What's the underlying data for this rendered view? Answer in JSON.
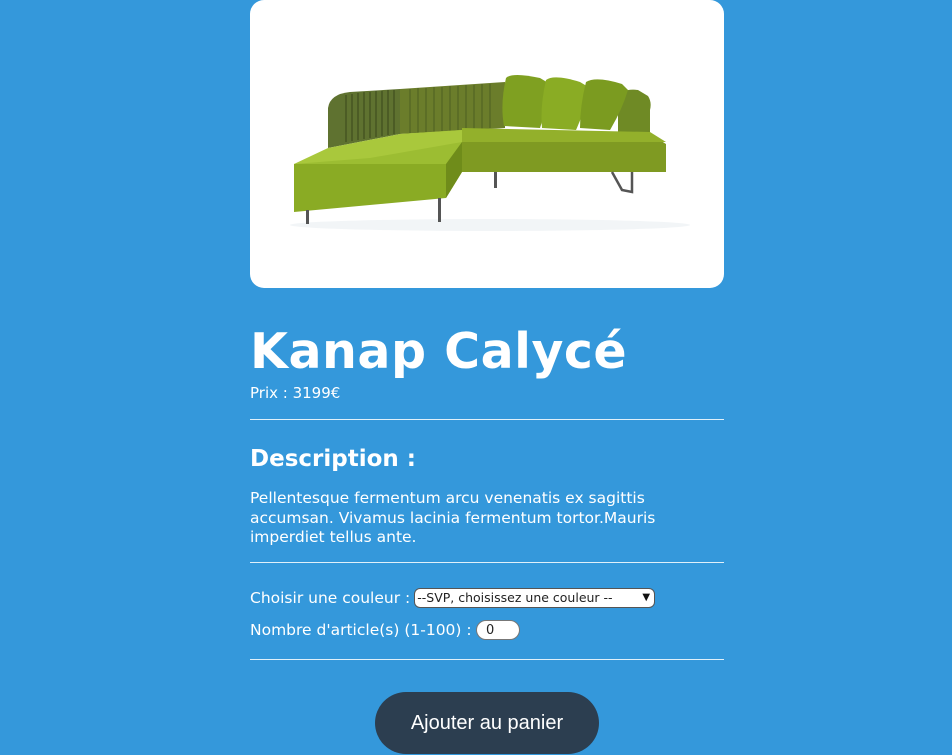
{
  "product": {
    "image_alt": "Photographie d'un canapé vert d'angle",
    "name": "Kanap Calycé",
    "price_label": "Prix : ",
    "price_value": "3199",
    "currency": "€",
    "description_title": "Description :",
    "description_text": "Pellentesque fermentum arcu venenatis ex sagittis accumsan. Vivamus lacinia fermentum tortor.Mauris imperdiet tellus ante."
  },
  "options": {
    "color_label": "Choisir une couleur :",
    "color_selected": "--SVP, choisissez une couleur --",
    "quantity_label": "Nombre d'article(s) (1-100) :",
    "quantity_value": "0"
  },
  "actions": {
    "add_to_cart_label": "Ajouter au panier"
  },
  "colors": {
    "background": "#3498db",
    "button": "#2c3e50",
    "sofa_green": "#8fae2a",
    "card": "#ffffff"
  }
}
